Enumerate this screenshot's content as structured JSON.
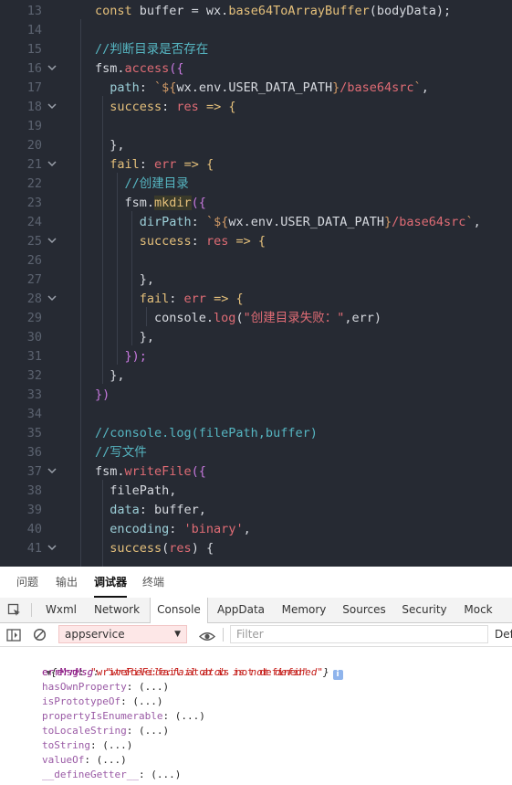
{
  "editor": {
    "line_numbers": [
      "13",
      "14",
      "15",
      "16",
      "17",
      "18",
      "19",
      "20",
      "21",
      "22",
      "23",
      "24",
      "25",
      "26",
      "27",
      "28",
      "29",
      "30",
      "31",
      "32",
      "33",
      "34",
      "35",
      "36",
      "37",
      "38",
      "39",
      "40",
      "41"
    ],
    "lines": [
      [
        {
          "t": "const ",
          "c": "k"
        },
        {
          "t": "buffer = wx.",
          "c": "w"
        },
        {
          "t": "base64ToArrayBuffer",
          "c": "y"
        },
        {
          "t": "(bodyData);",
          "c": "w"
        }
      ],
      [],
      [
        {
          "t": "//判断目录是否存在",
          "c": "c"
        }
      ],
      [
        {
          "t": "fsm.",
          "c": "w"
        },
        {
          "t": "access",
          "c": "fn"
        },
        {
          "t": "({",
          "c": "p"
        }
      ],
      [
        {
          "t": "  path",
          "c": "prop"
        },
        {
          "t": ": ",
          "c": "w"
        },
        {
          "t": "`${",
          "c": "str"
        },
        {
          "t": "wx.env.USER_DATA_PATH",
          "c": "w"
        },
        {
          "t": "}",
          "c": "str"
        },
        {
          "t": "/base64src",
          "c": "s2"
        },
        {
          "t": "`",
          "c": "str"
        },
        {
          "t": ",",
          "c": "w"
        }
      ],
      [
        {
          "t": "  success",
          "c": "k"
        },
        {
          "t": ": ",
          "c": "w"
        },
        {
          "t": "res",
          "c": "param"
        },
        {
          "t": " => {",
          "c": "arrow"
        }
      ],
      [],
      [
        {
          "t": "  },",
          "c": "w"
        }
      ],
      [
        {
          "t": "  fail",
          "c": "k"
        },
        {
          "t": ": ",
          "c": "w"
        },
        {
          "t": "err",
          "c": "param"
        },
        {
          "t": " => {",
          "c": "arrow"
        }
      ],
      [
        {
          "t": "    //创建目录",
          "c": "c"
        }
      ],
      [
        {
          "t": "    fsm.",
          "c": "w"
        },
        {
          "t": "mkdir",
          "c": "mk"
        },
        {
          "t": "({",
          "c": "p"
        }
      ],
      [
        {
          "t": "      dirPath",
          "c": "prop"
        },
        {
          "t": ": ",
          "c": "w"
        },
        {
          "t": "`${",
          "c": "str"
        },
        {
          "t": "wx.env.USER_DATA_PATH",
          "c": "w"
        },
        {
          "t": "}",
          "c": "str"
        },
        {
          "t": "/base64src",
          "c": "s2"
        },
        {
          "t": "`",
          "c": "str"
        },
        {
          "t": ",",
          "c": "w"
        }
      ],
      [
        {
          "t": "      success",
          "c": "k"
        },
        {
          "t": ": ",
          "c": "w"
        },
        {
          "t": "res",
          "c": "param"
        },
        {
          "t": " => {",
          "c": "arrow"
        }
      ],
      [],
      [
        {
          "t": "      },",
          "c": "w"
        }
      ],
      [
        {
          "t": "      fail",
          "c": "k"
        },
        {
          "t": ": ",
          "c": "w"
        },
        {
          "t": "err",
          "c": "param"
        },
        {
          "t": " => {",
          "c": "arrow"
        }
      ],
      [
        {
          "t": "        console.",
          "c": "w"
        },
        {
          "t": "log",
          "c": "fn"
        },
        {
          "t": "(",
          "c": "w"
        },
        {
          "t": "\"创建目录失败：\"",
          "c": "s2"
        },
        {
          "t": ",err)",
          "c": "w"
        }
      ],
      [
        {
          "t": "      },",
          "c": "w"
        }
      ],
      [
        {
          "t": "    });",
          "c": "p"
        }
      ],
      [
        {
          "t": "  },",
          "c": "w"
        }
      ],
      [
        {
          "t": "})",
          "c": "p"
        }
      ],
      [],
      [
        {
          "t": "//console.log(filePath,buffer)",
          "c": "c"
        }
      ],
      [
        {
          "t": "//写文件",
          "c": "c"
        }
      ],
      [
        {
          "t": "fsm.",
          "c": "w"
        },
        {
          "t": "writeFile",
          "c": "fn"
        },
        {
          "t": "({",
          "c": "p"
        }
      ],
      [
        {
          "t": "  filePath,",
          "c": "w"
        }
      ],
      [
        {
          "t": "  data",
          "c": "prop"
        },
        {
          "t": ": buffer,",
          "c": "w"
        }
      ],
      [
        {
          "t": "  encoding",
          "c": "prop"
        },
        {
          "t": ": ",
          "c": "w"
        },
        {
          "t": "'binary'",
          "c": "s2"
        },
        {
          "t": ",",
          "c": "w"
        }
      ],
      [
        {
          "t": "  success",
          "c": "k"
        },
        {
          "t": "(",
          "c": "w"
        },
        {
          "t": "res",
          "c": "param"
        },
        {
          "t": ") {",
          "c": "w"
        }
      ]
    ],
    "fold_lines": [
      3,
      5,
      8,
      12,
      15,
      24,
      28
    ]
  },
  "panel_tabs": [
    "问题",
    "输出",
    "调试器",
    "终端"
  ],
  "panel_active": "调试器",
  "devtools_tabs": [
    "Wxml",
    "Network",
    "Console",
    "AppData",
    "Memory",
    "Sources",
    "Security",
    "Mock"
  ],
  "devtools_active": "Console",
  "console_toolbar": {
    "context": "appservice",
    "filter_placeholder": "Filter",
    "levels_label": "Def"
  },
  "console_output": {
    "summary": "{errMsg: \"writeFile:fail atob is not defined\"}",
    "summary_key": "errMsg",
    "summary_value": "\"writeFile:fail atob is not defined\"",
    "info_badge": "i",
    "properties": [
      {
        "key": "errMsg",
        "value": "\"writeFile:fail atob is not defined\"",
        "own": true
      },
      {
        "key": "hasOwnProperty",
        "value": "(...)",
        "own": false
      },
      {
        "key": "isPrototypeOf",
        "value": "(...)",
        "own": false
      },
      {
        "key": "propertyIsEnumerable",
        "value": "(...)",
        "own": false
      },
      {
        "key": "toLocaleString",
        "value": "(...)",
        "own": false
      },
      {
        "key": "toString",
        "value": "(...)",
        "own": false
      },
      {
        "key": "valueOf",
        "value": "(...)",
        "own": false
      },
      {
        "key": "__defineGetter__",
        "value": "(...)",
        "own": false
      }
    ]
  }
}
